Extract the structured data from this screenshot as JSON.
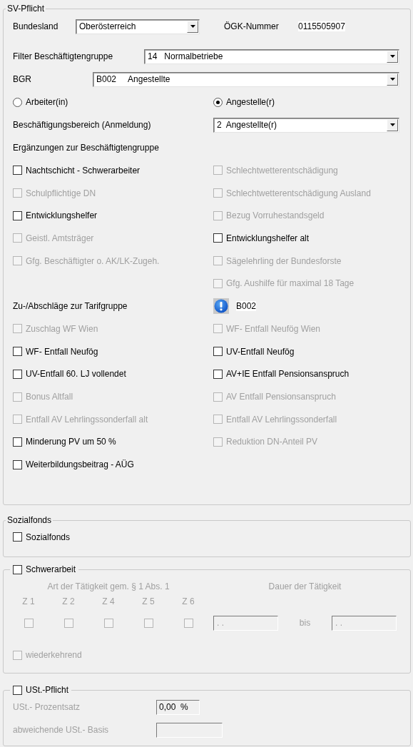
{
  "sv_pflicht": {
    "title": "SV-Pflicht",
    "bundesland": {
      "label": "Bundesland",
      "value": "Oberösterreich"
    },
    "oegk_nummer": {
      "label": "ÖGK-Nummer",
      "value": "0115505907"
    },
    "filter_beschaeftigtengruppe": {
      "label": "Filter Beschäftigtengruppe",
      "value": "14   Normalbetriebe"
    },
    "bgr": {
      "label": "BGR",
      "value": "B002     Angestellte"
    },
    "radios": [
      {
        "label": "Arbeiter(in)",
        "selected": false
      },
      {
        "label": "Angestelle(r)",
        "selected": true
      }
    ],
    "beschaeftigungsbereich": {
      "label": "Beschäftigungsbereich (Anmeldung)",
      "value": "2  Angestellte(r)"
    },
    "ergaenzungen": {
      "title": "Ergänzungen zur Beschäftigtengruppe",
      "left": [
        {
          "label": "Nachtschicht - Schwerarbeiter",
          "checked": false,
          "disabled": false
        },
        {
          "label": "Schulpflichtige DN",
          "checked": false,
          "disabled": true
        },
        {
          "label": "Entwicklungshelfer",
          "checked": false,
          "disabled": false
        },
        {
          "label": "Geistl. Amtsträger",
          "checked": false,
          "disabled": true
        },
        {
          "label": "Gfg. Beschäftigter o. AK/LK-Zugeh.",
          "checked": false,
          "disabled": true
        }
      ],
      "right": [
        {
          "label": "Schlechtwetterentschädigung",
          "checked": false,
          "disabled": true
        },
        {
          "label": "Schlechtwetterentschädigung Ausland",
          "checked": false,
          "disabled": true
        },
        {
          "label": "Bezug Vorruhestandsgeld",
          "checked": false,
          "disabled": true
        },
        {
          "label": "Entwicklungshelfer alt",
          "checked": false,
          "disabled": false
        },
        {
          "label": "Sägelehrling der Bundesforste",
          "checked": false,
          "disabled": true
        },
        {
          "label": "Gfg. Aushilfe für maximal 18 Tage",
          "checked": false,
          "disabled": true
        }
      ]
    },
    "zu_abschlaege": {
      "title": "Zu-/Abschläge zur Tarifgruppe",
      "value": "B002",
      "left": [
        {
          "label": "Zuschlag WF Wien",
          "checked": false,
          "disabled": true
        },
        {
          "label": "WF- Entfall Neufög",
          "checked": false,
          "disabled": false
        },
        {
          "label": "UV-Entfall 60. LJ vollendet",
          "checked": false,
          "disabled": false
        },
        {
          "label": "Bonus Altfall",
          "checked": false,
          "disabled": true
        },
        {
          "label": "Entfall AV Lehrlingssonderfall alt",
          "checked": false,
          "disabled": true
        },
        {
          "label": "Minderung PV um 50 %",
          "checked": false,
          "disabled": false
        },
        {
          "label": "Weiterbildungsbeitrag - AÜG",
          "checked": false,
          "disabled": false
        }
      ],
      "right": [
        {
          "label": "WF- Entfall Neufög Wien",
          "checked": false,
          "disabled": true
        },
        {
          "label": "UV-Entfall Neufög",
          "checked": false,
          "disabled": false
        },
        {
          "label": "AV+IE Entfall Pensionsanspruch",
          "checked": false,
          "disabled": false
        },
        {
          "label": "AV Entfall Pensionsanspruch",
          "checked": false,
          "disabled": true
        },
        {
          "label": "Entfall AV Lehrlingssonderfall",
          "checked": false,
          "disabled": true
        },
        {
          "label": "Reduktion DN-Anteil PV",
          "checked": false,
          "disabled": true
        }
      ]
    }
  },
  "sozialfonds": {
    "title": "Sozialfonds",
    "checkbox": {
      "label": "Sozialfonds",
      "checked": false,
      "disabled": false
    }
  },
  "schwerarbeit": {
    "checkbox": {
      "label": "Schwerarbeit",
      "checked": false,
      "disabled": false
    },
    "art_header": "Art der Tätigkeit gem. § 1 Abs. 1",
    "dauer_header": "Dauer der Tätigkeit",
    "z_items": [
      {
        "label": "Z 1",
        "checked": false,
        "disabled": true
      },
      {
        "label": "Z 2",
        "checked": false,
        "disabled": true
      },
      {
        "label": "Z 4",
        "checked": false,
        "disabled": true
      },
      {
        "label": "Z 5",
        "checked": false,
        "disabled": true
      },
      {
        "label": "Z 6",
        "checked": false,
        "disabled": true
      }
    ],
    "from": {
      "value": ". .",
      "disabled": true
    },
    "bis_label": "bis",
    "to": {
      "value": ". .",
      "disabled": true
    },
    "wiederkehrend": {
      "label": "wiederkehrend",
      "checked": false,
      "disabled": true
    }
  },
  "ust": {
    "checkbox": {
      "label": "USt.-Pflicht",
      "checked": false,
      "disabled": false
    },
    "prozentsatz": {
      "label": "USt.- Prozentsatz",
      "value": "0,00  %",
      "disabled": true
    },
    "basis": {
      "label": "abweichende USt.- Basis",
      "disabled": true
    }
  }
}
